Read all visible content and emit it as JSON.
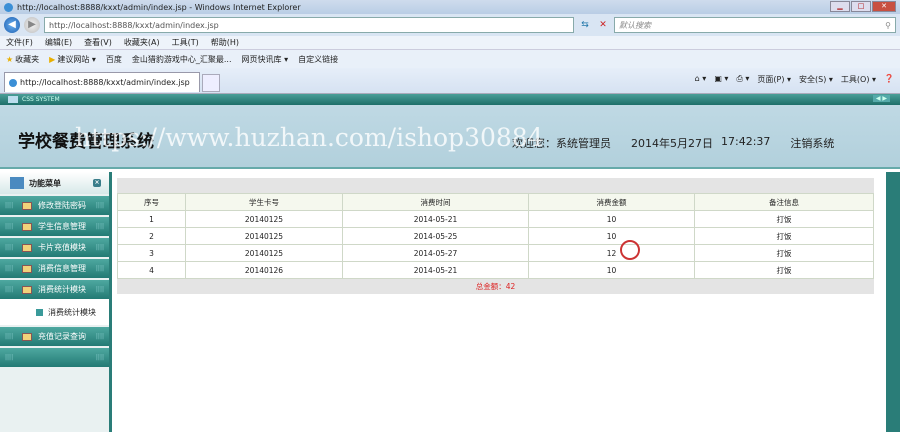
{
  "browser": {
    "window_title": "http://localhost:8888/kxxt/admin/index.jsp - Windows Internet Explorer",
    "url": "http://localhost:8888/kxxt/admin/index.jsp",
    "search_placeholder": "默认搜索",
    "tab_title": "http://localhost:8888/kxxt/admin/index.jsp",
    "menu": [
      "文件(F)",
      "编辑(E)",
      "查看(V)",
      "收藏夹(A)",
      "工具(T)",
      "帮助(H)"
    ],
    "favorites": [
      "收藏夹",
      "建议网站 ▾",
      "百度",
      "金山猎豹游戏中心_汇聚最...",
      "网页快讯库 ▾",
      "自定义链接"
    ],
    "commands": [
      "页面(P) ▾",
      "安全(S) ▾",
      "工具(O) ▾"
    ]
  },
  "app": {
    "bar_label": "CSS SYSTEM",
    "title": "学校餐费管理系统",
    "welcome": "欢迎您：系统管理员",
    "date": "2014年5月27日",
    "time": "17:42:37",
    "logout": "注销系统",
    "watermark": "https://www.huzhan.com/ishop30884"
  },
  "sidebar": {
    "header": "功能菜单",
    "items": [
      "修改登陆密码",
      "学生信息管理",
      "卡片充值模块",
      "消费信息管理",
      "消费统计模块"
    ],
    "subitem": "消费统计模块",
    "after": [
      "充值记录查询"
    ]
  },
  "table": {
    "headers": [
      "序号",
      "学生卡号",
      "消费时间",
      "消费金额",
      "备注信息"
    ],
    "rows": [
      [
        "1",
        "20140125",
        "2014-05-21",
        "10",
        "打饭"
      ],
      [
        "2",
        "20140125",
        "2014-05-25",
        "10",
        "打饭"
      ],
      [
        "3",
        "20140125",
        "2014-05-27",
        "12",
        "打饭"
      ],
      [
        "4",
        "20140126",
        "2014-05-21",
        "10",
        "打饭"
      ]
    ],
    "total": "总金额：42"
  }
}
